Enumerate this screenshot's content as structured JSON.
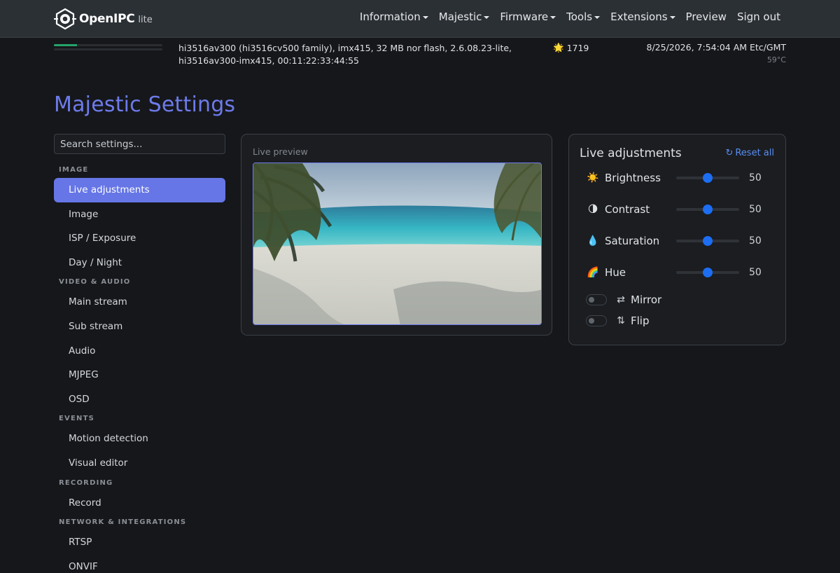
{
  "navbar": {
    "brand": "OpenIPC",
    "brand_sub": "lite",
    "items": [
      {
        "label": "Information",
        "dropdown": true
      },
      {
        "label": "Majestic",
        "dropdown": true
      },
      {
        "label": "Firmware",
        "dropdown": true
      },
      {
        "label": "Tools",
        "dropdown": true
      },
      {
        "label": "Extensions",
        "dropdown": true
      },
      {
        "label": "Preview",
        "dropdown": false
      },
      {
        "label": "Sign out",
        "dropdown": false
      }
    ]
  },
  "status": {
    "system_info": "hi3516av300 (hi3516cv500 family), imx415, 32 MB nor flash, 2.6.08.23-lite, hi3516av300-imx415, 00:11:22:33:44:55",
    "uptime_icon": "star-icon",
    "uptime": "1719",
    "datetime": "8/25/2026, 7:54:04 AM Etc/GMT",
    "temperature": "59°C",
    "bar_fill": [
      0.21,
      0.0
    ]
  },
  "page": {
    "title": "Majestic Settings"
  },
  "search": {
    "placeholder": "Search settings..."
  },
  "sidebar": {
    "sections": [
      {
        "title": "IMAGE",
        "items": [
          "Live adjustments",
          "Image",
          "ISP / Exposure",
          "Day / Night"
        ]
      },
      {
        "title": "VIDEO & AUDIO",
        "items": [
          "Main stream",
          "Sub stream",
          "Audio",
          "MJPEG",
          "OSD"
        ]
      },
      {
        "title": "EVENTS",
        "items": [
          "Motion detection",
          "Visual editor"
        ]
      },
      {
        "title": "RECORDING",
        "items": [
          "Record"
        ]
      },
      {
        "title": "NETWORK & INTEGRATIONS",
        "items": [
          "RTSP",
          "ONVIF"
        ]
      }
    ],
    "active": "Live adjustments"
  },
  "preview": {
    "label": "Live preview"
  },
  "adjustments": {
    "title": "Live adjustments",
    "reset_label": "Reset all",
    "sliders": [
      {
        "label": "Brightness",
        "value": "50",
        "icon": "sun-icon",
        "glyph": "☀️",
        "level": 0.5
      },
      {
        "label": "Contrast",
        "value": "50",
        "icon": "contrast-icon",
        "glyph": "🌗",
        "level": 0.5
      },
      {
        "label": "Saturation",
        "value": "50",
        "icon": "droplet-icon",
        "glyph": "💧",
        "level": 0.5
      },
      {
        "label": "Hue",
        "value": "50",
        "icon": "rainbow-icon",
        "glyph": "🌈",
        "level": 0.5
      }
    ],
    "toggles": [
      {
        "label": "Mirror",
        "icon": "mirror-icon",
        "glyph": "⇄",
        "on": false
      },
      {
        "label": "Flip",
        "icon": "flip-icon",
        "glyph": "⇅",
        "on": false
      }
    ]
  }
}
